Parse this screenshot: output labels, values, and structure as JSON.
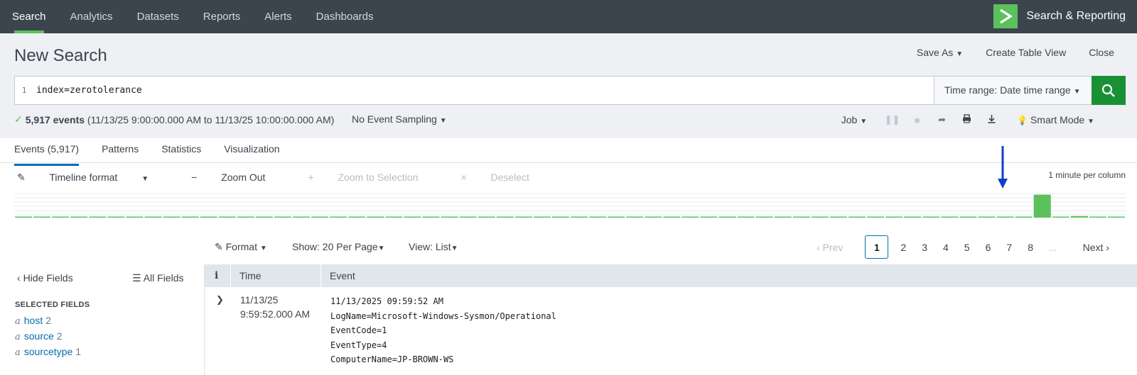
{
  "topnav": {
    "items": [
      "Search",
      "Analytics",
      "Datasets",
      "Reports",
      "Alerts",
      "Dashboards"
    ],
    "active_index": 0,
    "app_title": "Search & Reporting",
    "app_logo_icon": "chevron-right-icon",
    "accent_color": "#5cc05c",
    "bar_color": "#3c444d"
  },
  "header": {
    "title": "New Search",
    "save_as": "Save As",
    "create_table_view": "Create Table View",
    "close": "Close"
  },
  "search": {
    "line_number": "1",
    "query": "index=zerotolerance",
    "time_range": "Time range: Date time range",
    "search_button_icon": "search-icon"
  },
  "status": {
    "event_count": "5,917 events",
    "range_text": "(11/13/25 9:00:00.000 AM to 11/13/25 10:00:00.000 AM)",
    "sampling": "No Event Sampling",
    "job": "Job",
    "mode": "Smart Mode"
  },
  "tabs": [
    {
      "label": "Events (5,917)",
      "active": true
    },
    {
      "label": "Patterns",
      "active": false
    },
    {
      "label": "Statistics",
      "active": false
    },
    {
      "label": "Visualization",
      "active": false
    }
  ],
  "timeline": {
    "format": "Timeline format",
    "zoom_out": "Zoom Out",
    "zoom_selection": "Zoom to Selection",
    "deselect": "Deselect",
    "per_column": "1 minute per column",
    "columns": 60,
    "peak_column": 55,
    "peak_level": 0.9,
    "minor_column": 57,
    "minor_level": 0.06,
    "bar_color": "#5cc05c",
    "annotation_color": "#1040c8"
  },
  "results": {
    "format": "Format",
    "show": "Show: 20 Per Page",
    "view": "View: List",
    "prev": "Prev",
    "pages": [
      "1",
      "2",
      "3",
      "4",
      "5",
      "6",
      "7",
      "8"
    ],
    "current_page": "1",
    "ellipsis": "...",
    "next": "Next"
  },
  "sidebar": {
    "hide_fields": "Hide Fields",
    "all_fields": "All Fields",
    "selected_heading": "SELECTED FIELDS",
    "fields": [
      {
        "type": "a",
        "name": "host",
        "count": "2"
      },
      {
        "type": "a",
        "name": "source",
        "count": "2"
      },
      {
        "type": "a",
        "name": "sourcetype",
        "count": "1"
      }
    ]
  },
  "events_table": {
    "columns": [
      "i",
      "Time",
      "Event"
    ],
    "rows": [
      {
        "time_date": "11/13/25",
        "time_clock": "9:59:52.000 AM",
        "lines": [
          "11/13/2025 09:59:52 AM",
          "LogName=Microsoft-Windows-Sysmon/Operational",
          "EventCode=1",
          "EventType=4",
          "ComputerName=JP-BROWN-WS"
        ]
      }
    ]
  }
}
